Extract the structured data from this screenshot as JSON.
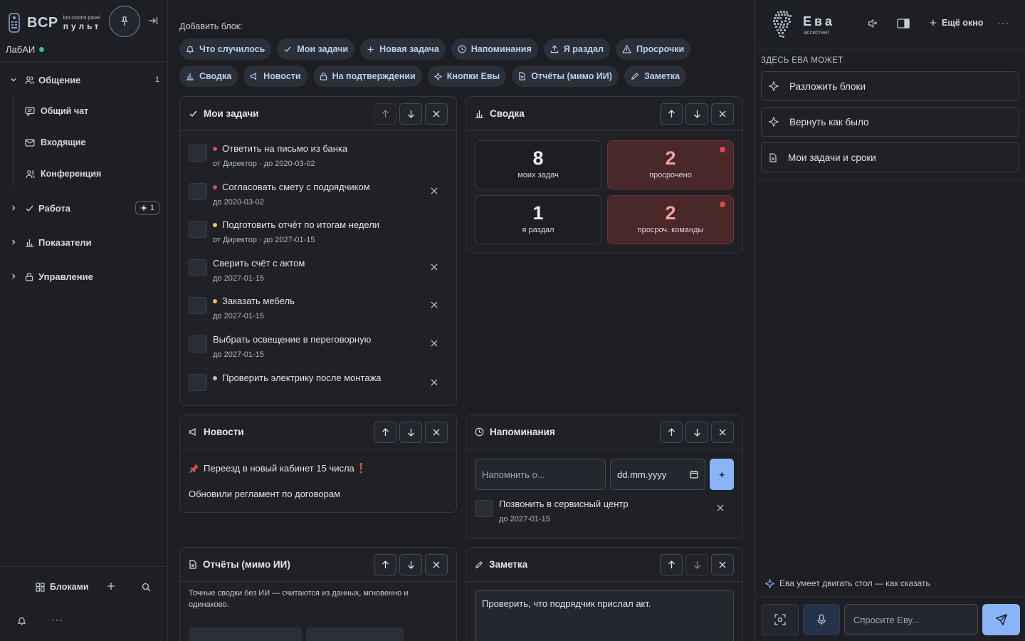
{
  "brand": {
    "name": "BCP",
    "tagline": "bot control panel",
    "subtitle": "пульт"
  },
  "org": {
    "name": "ЛабАИ",
    "status_color": "#3fbf7a"
  },
  "nav": {
    "communication": {
      "label": "Общение",
      "count": "1"
    },
    "communication_items": [
      "Общий чат",
      "Входящие",
      "Конференция"
    ],
    "work": {
      "label": "Работа",
      "badge": "1"
    },
    "metrics": {
      "label": "Показатели"
    },
    "management": {
      "label": "Управление"
    }
  },
  "sidebar_bottom": {
    "blocks_label": "Блоками"
  },
  "add_block": {
    "label": "Добавить блок:",
    "row1": [
      "Что случилось",
      "Мои задачи",
      "Новая задача",
      "Напоминания",
      "Я раздал",
      "Просрочки"
    ],
    "row2": [
      "Сводка",
      "Новости",
      "На подтверждении",
      "Кнопки Евы",
      "Отчёты (мимо ИИ)",
      "Заметка"
    ]
  },
  "my_tasks": {
    "title": "Мои задачи",
    "items": [
      {
        "title": "Ответить на письмо из банка",
        "meta": "от Директор · до 2020-03-02",
        "priority": "red"
      },
      {
        "title": "Согласовать смету с подрядчиком",
        "meta": "до 2020-03-02",
        "priority": "red"
      },
      {
        "title": "Подготовить отчёт по итогам недели",
        "meta": "от Директор · до 2027-01-15",
        "priority": "yellow"
      },
      {
        "title": "Сверить счёт с актом",
        "meta": "до 2027-01-15",
        "priority": "none"
      },
      {
        "title": "Заказать мебель",
        "meta": "до 2027-01-15",
        "priority": "yellow"
      },
      {
        "title": "Выбрать освещение в переговорную",
        "meta": "до 2027-01-15",
        "priority": "none"
      },
      {
        "title": "Проверить электрику после монтажа",
        "meta": "",
        "priority": "gray"
      }
    ]
  },
  "summary": {
    "title": "Сводка",
    "stats": [
      {
        "value": "8",
        "label": "моих задач"
      },
      {
        "value": "2",
        "label": "просрочено"
      },
      {
        "value": "1",
        "label": "я раздал"
      },
      {
        "value": "2",
        "label": "просроч. команды"
      }
    ]
  },
  "news": {
    "title": "Новости",
    "items": [
      "Переезд в новый кабинет 15 числа",
      "Обновили регламент по договорам"
    ]
  },
  "reminders": {
    "title": "Напоминания",
    "input_placeholder": "Напомнить о...",
    "date_placeholder": "dd.mm.yyyy",
    "add_label": "+",
    "items": [
      {
        "title": "Позвонить в сервисный центр",
        "meta": "до 2027-01-15"
      }
    ]
  },
  "reports": {
    "title": "Отчёты (мимо ИИ)",
    "description": "Точные сводки без ИИ — считаются из данных, мгновенно и одинаково."
  },
  "note": {
    "title": "Заметка",
    "text": "Проверить, что подрядчик прислал акт."
  },
  "assistant": {
    "name": "Ева",
    "role": "ассистент",
    "more_window": "Ещё окно",
    "section_label": "ЗДЕСЬ ЕВА МОЖЕТ",
    "actions": [
      "Разложить блоки",
      "Вернуть как было",
      "Мои задачи и сроки"
    ],
    "hint": "Ева умеет двигать стол — как сказать",
    "input_placeholder": "Спросите Еву..."
  },
  "colors": {
    "accent": "#8ab4f8",
    "danger": "#e0484a",
    "warning": "#f2c14e",
    "chip_text": "#b8cff3"
  }
}
